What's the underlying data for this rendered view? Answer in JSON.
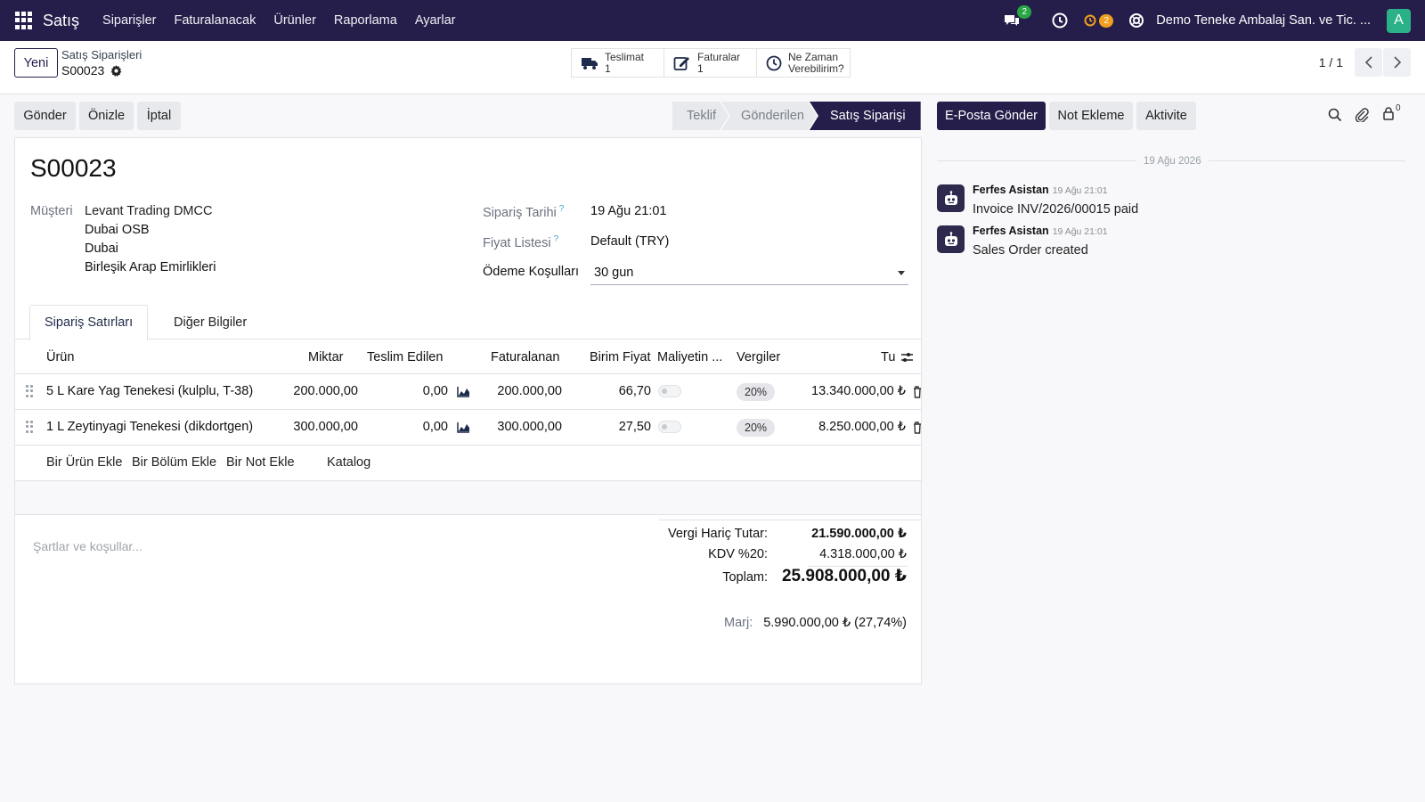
{
  "topbar": {
    "app_name": "Satış",
    "menu": [
      "Siparişler",
      "Faturalanacak",
      "Ürünler",
      "Raporlama",
      "Ayarlar"
    ],
    "chat_badge": "2",
    "activity_badge": "2",
    "company": "Demo Teneke Ambalaj San. ve Tic. ...",
    "avatar_letter": "A"
  },
  "control": {
    "new_button": "Yeni",
    "breadcrumb_parent": "Satış Siparişleri",
    "breadcrumb_current": "S00023",
    "smart_buttons": [
      {
        "label": "Teslimat",
        "count": "1",
        "icon": "truck-icon"
      },
      {
        "label": "Faturalar",
        "count": "1",
        "icon": "invoice-icon"
      },
      {
        "label": "Ne Zaman",
        "count": "Verebilirim?",
        "icon": "clock-icon"
      }
    ],
    "pager": "1 / 1"
  },
  "actions": {
    "send": "Gönder",
    "preview": "Önizle",
    "cancel": "İptal"
  },
  "status_stages": [
    "Teklif",
    "Gönderilen",
    "Satış Siparişi"
  ],
  "status_active": "Satış Siparişi",
  "form": {
    "title": "S00023",
    "customer_label": "Müşteri",
    "customer_lines": [
      "Levant Trading DMCC",
      "Dubai OSB",
      "Dubai",
      "Birleşik Arap Emirlikleri"
    ],
    "order_date_label": "Sipariş Tarihi",
    "order_date": "19 Ağu 21:01",
    "pricelist_label": "Fiyat Listesi",
    "pricelist": "Default (TRY)",
    "payment_terms_label": "Ödeme Koşulları",
    "payment_terms": "30 gun",
    "help_mark": "?"
  },
  "tabs": [
    "Sipariş Satırları",
    "Diğer Bilgiler"
  ],
  "table": {
    "headers": {
      "product": "Ürün",
      "qty": "Miktar",
      "delivered": "Teslim Edilen",
      "invoiced": "Faturalanan",
      "unit_price": "Birim Fiyat",
      "cost": "Maliyetin ...",
      "taxes": "Vergiler",
      "total": "Tu"
    },
    "rows": [
      {
        "product": "5 L Kare Yag Tenekesi (kulplu, T-38)",
        "qty": "200.000,00",
        "delivered": "0,00",
        "invoiced": "200.000,00",
        "unit_price": "66,70",
        "tax": "20%",
        "subtotal": "13.340.000,00 ₺"
      },
      {
        "product": "1 L Zeytinyagi Tenekesi (dikdortgen)",
        "qty": "300.000,00",
        "delivered": "0,00",
        "invoiced": "300.000,00",
        "unit_price": "27,50",
        "tax": "20%",
        "subtotal": "8.250.000,00 ₺"
      }
    ],
    "add_links": [
      "Bir Ürün Ekle",
      "Bir Bölüm Ekle",
      "Bir Not Ekle",
      "Katalog"
    ]
  },
  "footer": {
    "terms_placeholder": "Şartlar ve koşullar...",
    "untaxed_label": "Vergi Hariç Tutar:",
    "untaxed_value": "21.590.000,00 ₺",
    "vat_label": "KDV %20:",
    "vat_value": "4.318.000,00 ₺",
    "total_label": "Toplam:",
    "total_value": "25.908.000,00 ₺",
    "margin_label": "Marj:",
    "margin_value": "5.990.000,00 ₺ (27,74%)"
  },
  "chatter": {
    "send_email": "E-Posta Gönder",
    "log_note": "Not Ekleme",
    "activity": "Aktivite",
    "followers_count": "0",
    "date_divider": "19 Ağu 2026",
    "messages": [
      {
        "author": "Ferfes Asistan",
        "time": "19 Ağu 21:01",
        "body": "Invoice INV/2026/00015 paid"
      },
      {
        "author": "Ferfes Asistan",
        "time": "19 Ağu 21:01",
        "body": "Sales Order created"
      }
    ]
  },
  "colors": {
    "brand": "#251e4a",
    "badge_green": "#28a745",
    "badge_orange": "#f0a020",
    "avatar": "#2bb187"
  }
}
